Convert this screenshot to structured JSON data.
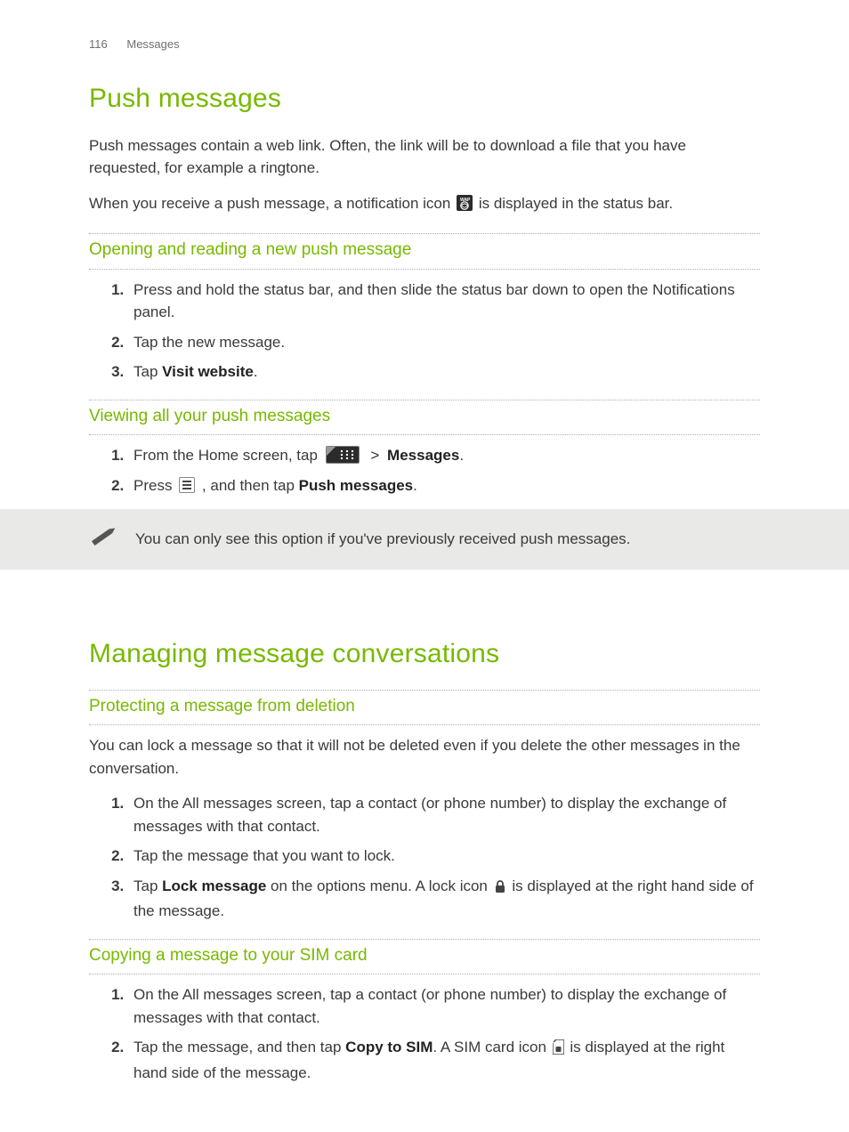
{
  "breadcrumb": {
    "page_number": "116",
    "section": "Messages"
  },
  "h1_push": "Push messages",
  "push_intro": "Push messages contain a web link. Often, the link will be to download a file that you have requested, for example a ringtone.",
  "push_p2_a": "When you receive a push message, a notification icon ",
  "push_p2_b": " is displayed in the status bar.",
  "h2_open": "Opening and reading a new push message",
  "open_steps": [
    "Press and hold the status bar, and then slide the status bar down to open the Notifications panel.",
    "Tap the new message.",
    {
      "pre": "Tap ",
      "bold": "Visit website",
      "post": "."
    }
  ],
  "h2_viewall": "Viewing all your push messages",
  "view_step1_a": "From the Home screen, tap ",
  "view_step1_chev": ">",
  "view_step1_bold": "Messages",
  "view_step1_post": ".",
  "view_step2_a": "Press ",
  "view_step2_b": ", and then tap ",
  "view_step2_bold": "Push messages",
  "view_step2_post": ".",
  "note_text": "You can only see this option if you've previously received push messages.",
  "h1_manage": "Managing message conversations",
  "h2_protect": "Protecting a message from deletion",
  "protect_intro": "You can lock a message so that it will not be deleted even if you delete the other messages in the conversation.",
  "protect_steps": {
    "s1": "On the All messages screen, tap a contact (or phone number) to display the exchange of messages with that contact.",
    "s2": "Tap the message that you want to lock.",
    "s3_a": "Tap ",
    "s3_bold": "Lock message",
    "s3_b": " on the options menu. A lock icon ",
    "s3_c": " is displayed at the right hand side of the message."
  },
  "h2_copy": "Copying a message to your SIM card",
  "copy_steps": {
    "s1": "On the All messages screen, tap a contact (or phone number) to display the exchange of messages with that contact.",
    "s2_a": "Tap the message, and then tap ",
    "s2_bold": "Copy to SIM",
    "s2_b": ". A SIM card icon ",
    "s2_c": " is displayed at the right hand side of the message."
  }
}
